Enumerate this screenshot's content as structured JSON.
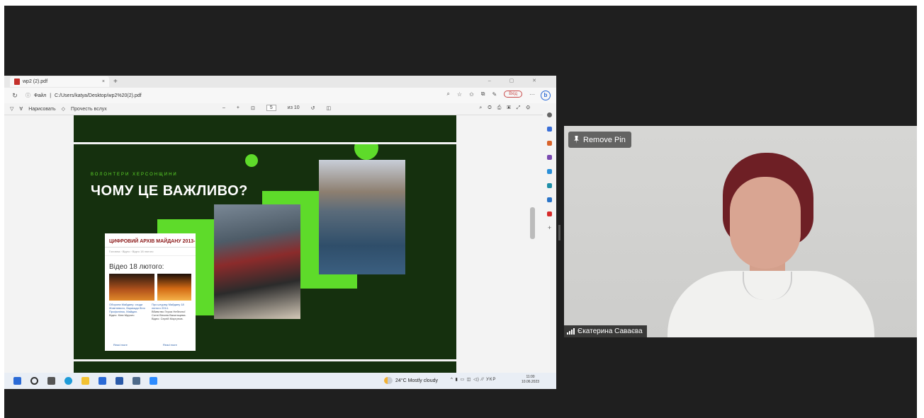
{
  "browser": {
    "tab_title": "wp2 (2).pdf",
    "tab_close": "×",
    "new_tab": "+",
    "window_controls": "–  ▢  ✕",
    "url_label": "Файл",
    "url": "C:/Users/katya/Desktop/wp2%20(2).pdf",
    "login_label": "Вхід",
    "more": "···",
    "bing": "b"
  },
  "pdf_toolbar": {
    "draw_label": "Нарисовать",
    "read_aloud_label": "Прочесть вслух",
    "zoom_minus": "–",
    "zoom_plus": "+",
    "page_current": "5",
    "page_total": "из 10"
  },
  "slide": {
    "kicker": "ВОЛОНТЕРИ ХЕРСОНЩИНИ",
    "title": "ЧОМУ ЦЕ ВАЖЛИВО?",
    "web_card": {
      "header": "ЦИФРОВИЙ АРХІВ МАЙДАНУ 2013-",
      "breadcrumbs": "Головна › Відео › Відео 18 лютого",
      "video_title": "Відео 18 лютого:",
      "caption_1": "Оборона Майдану: сходи Жовтневого, барикади біля Профспілок, Майдан.",
      "caption_1_meta": "Відео: Kiев Мручич",
      "caption_2": "Про штурму Майдану 18 лютого 2014.",
      "caption_2_meta": "Вбивство Героя Небесної Сотні Віталія Васильцева. Відео: Сергій Моргунов.",
      "read_more_1": "Read more",
      "read_more_2": "Read more"
    }
  },
  "taskbar": {
    "weather": "24°C  Mostly cloudy",
    "tray": "^  ▮  ▭  ◫  ◁)  ⁄⁄  УКР",
    "time": "11:00",
    "date": "10.06.2023"
  },
  "video": {
    "remove_pin_label": "Remove Pin",
    "participant_name": "Єкатерина Саваєва"
  }
}
